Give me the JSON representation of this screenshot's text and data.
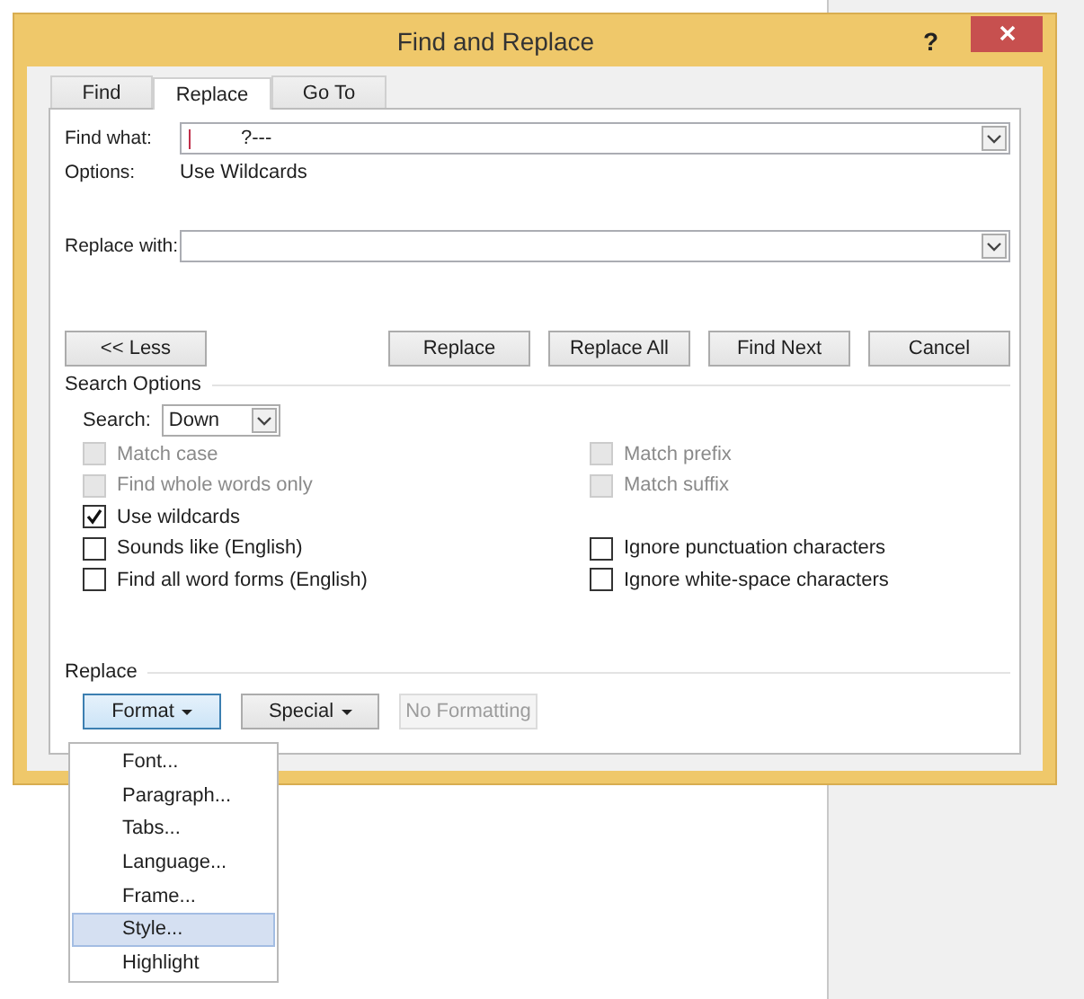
{
  "window": {
    "title": "Find and Replace",
    "help": "?"
  },
  "tabs": [
    {
      "label": "Find",
      "selected": false
    },
    {
      "label": "Replace",
      "selected": true
    },
    {
      "label": "Go To",
      "selected": false
    }
  ],
  "find_what": {
    "label": "Find what:",
    "value": "?---"
  },
  "options": {
    "label": "Options:",
    "value": "Use Wildcards"
  },
  "replace_with": {
    "label": "Replace with:"
  },
  "buttons": [
    {
      "label": "<< Less"
    },
    {
      "label": "Replace"
    },
    {
      "label": "Replace All"
    },
    {
      "label": "Find Next"
    },
    {
      "label": "Cancel"
    }
  ],
  "search_options": {
    "title": "Search Options",
    "search_label": "Search:",
    "search_value": "Down",
    "rows": [
      {
        "left": {
          "label": "Match case",
          "checked": false,
          "disabled": true
        },
        "right": {
          "label": "Match prefix",
          "checked": false,
          "disabled": true
        }
      },
      {
        "left": {
          "label": "Find whole words only",
          "checked": false,
          "disabled": true
        },
        "right": {
          "label": "Match suffix",
          "checked": false,
          "disabled": true
        }
      },
      {
        "left": {
          "label": "Use wildcards",
          "checked": true,
          "disabled": false
        }
      },
      {
        "left": {
          "label": "Sounds like (English)",
          "checked": false,
          "disabled": false
        },
        "right": {
          "label": "Ignore punctuation characters",
          "checked": false,
          "disabled": false
        }
      },
      {
        "left": {
          "label": "Find all word forms (English)",
          "checked": false,
          "disabled": false
        },
        "right": {
          "label": "Ignore white-space characters",
          "checked": false,
          "disabled": false
        }
      }
    ]
  },
  "replace_section": {
    "title": "Replace",
    "buttons": [
      {
        "label": "Format",
        "dropdown": true,
        "pressed": true,
        "disabled": false
      },
      {
        "label": "Special",
        "dropdown": true,
        "pressed": false,
        "disabled": false
      },
      {
        "label": "No Formatting",
        "dropdown": false,
        "pressed": false,
        "disabled": true
      }
    ]
  },
  "format_menu": [
    {
      "label": "Font...",
      "selected": false
    },
    {
      "label": "Paragraph...",
      "selected": false
    },
    {
      "label": "Tabs...",
      "selected": false
    },
    {
      "label": "Language...",
      "selected": false
    },
    {
      "label": "Frame...",
      "selected": false
    },
    {
      "label": "Style...",
      "selected": true
    },
    {
      "label": "Highlight",
      "selected": false
    }
  ]
}
